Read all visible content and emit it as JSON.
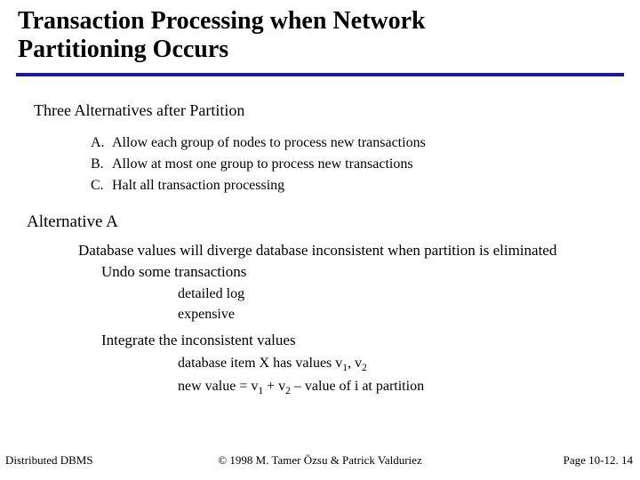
{
  "title": {
    "line1": "Transaction Processing when Network",
    "line2": "Partitioning Occurs"
  },
  "section_heading": "Three Alternatives after Partition",
  "alternatives": [
    {
      "letter": "A.",
      "text": "Allow each group of nodes to process new transactions"
    },
    {
      "letter": "B.",
      "text": "Allow at most one group to process new transactions"
    },
    {
      "letter": "C.",
      "text": "Halt all transaction processing"
    }
  ],
  "alt_a_heading": "Alternative A",
  "alt_a_para": "Database values will diverge database inconsistent when partition is eliminated",
  "undo_heading": "Undo some transactions",
  "undo_items": [
    "detailed log",
    "expensive"
  ],
  "integrate_heading": "Integrate the inconsistent values",
  "integrate_line1": {
    "pre": "database item X has values v",
    "sub1": "1",
    "mid": ", v",
    "sub2": "2"
  },
  "integrate_line2": {
    "pre": "new value = v",
    "sub1": "1",
    "mid": " + v",
    "sub2": "2",
    "post": " – value of i at partition"
  },
  "footer": {
    "left": "Distributed DBMS",
    "center": "© 1998 M. Tamer Özsu & Patrick Valduriez",
    "right": "Page 10-12. 14"
  }
}
